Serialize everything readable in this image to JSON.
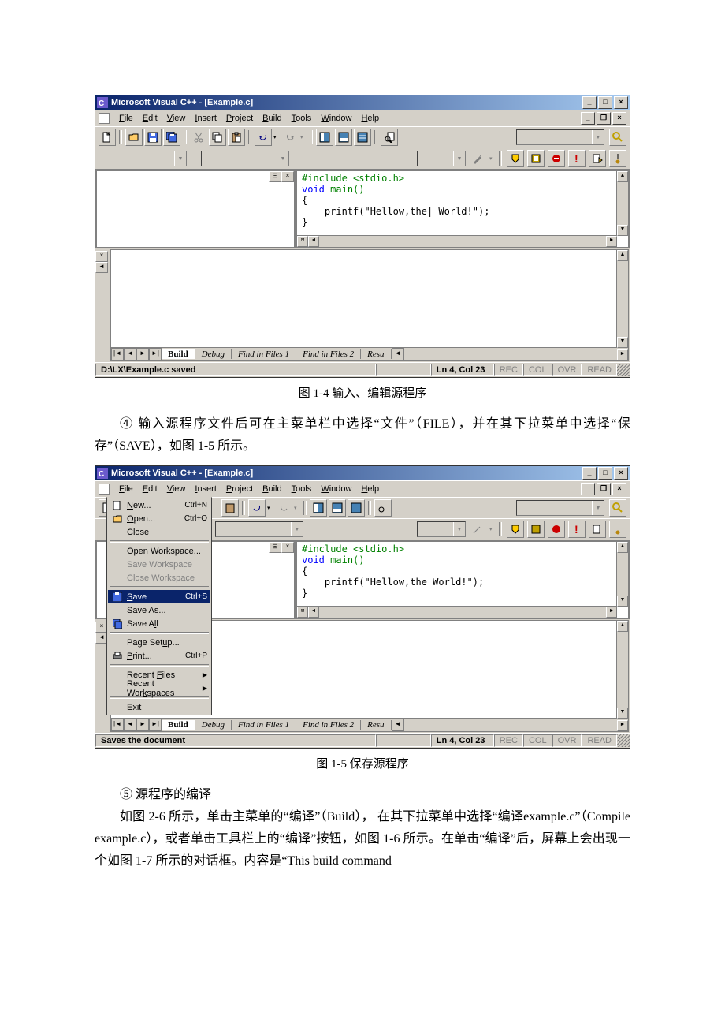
{
  "fig1": {
    "title": "Microsoft Visual C++ - [Example.c]",
    "menus": {
      "file": "File",
      "edit": "Edit",
      "view": "View",
      "insert": "Insert",
      "project": "Project",
      "build": "Build",
      "tools": "Tools",
      "window": "Window",
      "help": "Help"
    },
    "code": {
      "l1": "#include <stdio.h>",
      "l2": "void main()",
      "l3": "{",
      "l4": "    printf(\"Hellow,the| World!\");",
      "l5": "}"
    },
    "out_tabs": {
      "build": "Build",
      "debug": "Debug",
      "f1": "Find in Files 1",
      "f2": "Find in Files 2",
      "res": "Resu"
    },
    "status_main": "D:\\LX\\Example.c saved",
    "status_pos": "Ln 4, Col 23",
    "status_flags": {
      "rec": "REC",
      "col": "COL",
      "ovr": "OVR",
      "read": "READ"
    }
  },
  "caption1": "图 1-4  输入、编辑源程序",
  "para1": "④ 输入源程序文件后可在主菜单栏中选择“文件”（FILE），并在其下拉菜单中选择“保存”（SAVE），如图 1-5 所示。",
  "fig2": {
    "title": "Microsoft Visual C++ - [Example.c]",
    "menus": {
      "file": "File",
      "edit": "Edit",
      "view": "View",
      "insert": "Insert",
      "project": "Project",
      "build": "Build",
      "tools": "Tools",
      "window": "Window",
      "help": "Help"
    },
    "filemenu": {
      "new": {
        "lbl": "New...",
        "sc": "Ctrl+N"
      },
      "open": {
        "lbl": "Open...",
        "sc": "Ctrl+O"
      },
      "close": {
        "lbl": "Close"
      },
      "openws": {
        "lbl": "Open Workspace..."
      },
      "savews": {
        "lbl": "Save Workspace"
      },
      "closews": {
        "lbl": "Close Workspace"
      },
      "save": {
        "lbl": "Save",
        "sc": "Ctrl+S"
      },
      "saveas": {
        "lbl": "Save As..."
      },
      "saveall": {
        "lbl": "Save All"
      },
      "pagesetup": {
        "lbl": "Page Setup..."
      },
      "print": {
        "lbl": "Print...",
        "sc": "Ctrl+P"
      },
      "recentf": {
        "lbl": "Recent Files"
      },
      "recentw": {
        "lbl": "Recent Workspaces"
      },
      "exit": {
        "lbl": "Exit"
      }
    },
    "code": {
      "l1": "#include <stdio.h>",
      "l2": "void main()",
      "l3": "{",
      "l4": "    printf(\"Hellow,the World!\");",
      "l5": "}"
    },
    "out_tabs": {
      "build": "Build",
      "debug": "Debug",
      "f1": "Find in Files 1",
      "f2": "Find in Files 2",
      "res": "Resu"
    },
    "status_main": "Saves the document",
    "status_pos": "Ln 4, Col 23",
    "status_flags": {
      "rec": "REC",
      "col": "COL",
      "ovr": "OVR",
      "read": "READ"
    }
  },
  "caption2": "图 1-5  保存源程序",
  "para2_header": "⑤  源程序的编译",
  "para2_body": "如图 2-6 所示，单击主菜单的“编译”（Build），  在其下拉菜单中选择“编译example.c”（Compile example.c），或者单击工具栏上的“编译”按钮，如图 1-6 所示。在单击“编译”后，屏幕上会出现一个如图 1-7 所示的对话框。内容是“This build command"
}
